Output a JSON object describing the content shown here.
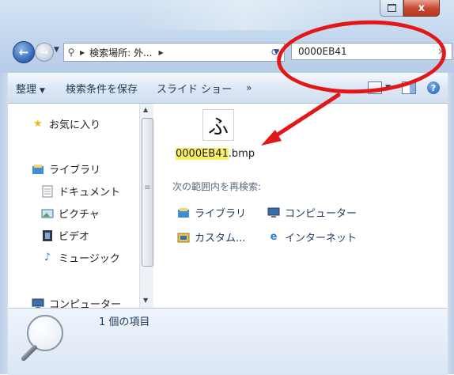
{
  "window": {
    "caption_close_glyph": "x",
    "accent_red": "#e21818"
  },
  "nav": {
    "back_glyph": "←",
    "forward_glyph": "→",
    "address_text": "検索場所: 外...",
    "search_value": "0000EB41",
    "clear_glyph": "×"
  },
  "toolbar": {
    "organize": "整理",
    "save_search": "検索条件を保存",
    "slideshow": "スライド ショー",
    "more": "»",
    "help": "?"
  },
  "sidebar": {
    "items": [
      {
        "label": "お気に入り",
        "icon": "star-icon"
      },
      {
        "label": "ライブラリ",
        "icon": "library-icon"
      },
      {
        "label": "ドキュメント",
        "icon": "document-icon"
      },
      {
        "label": "ピクチャ",
        "icon": "picture-icon"
      },
      {
        "label": "ビデオ",
        "icon": "video-icon"
      },
      {
        "label": "ミュージック",
        "icon": "music-icon"
      },
      {
        "label": "コンピューター",
        "icon": "computer-icon"
      }
    ]
  },
  "results": {
    "file_thumb_char": "ふ",
    "file_highlight": "0000EB41",
    "file_ext": ".bmp",
    "research_label": "次の範囲内を再検索:",
    "locations": [
      {
        "label": "ライブラリ",
        "icon": "library-icon"
      },
      {
        "label": "コンピューター",
        "icon": "computer-icon"
      },
      {
        "label": "カスタム...",
        "icon": "custom-folder-icon"
      },
      {
        "label": "インターネット",
        "icon": "internet-icon"
      }
    ]
  },
  "details": {
    "count_text": "1 個の項目"
  }
}
